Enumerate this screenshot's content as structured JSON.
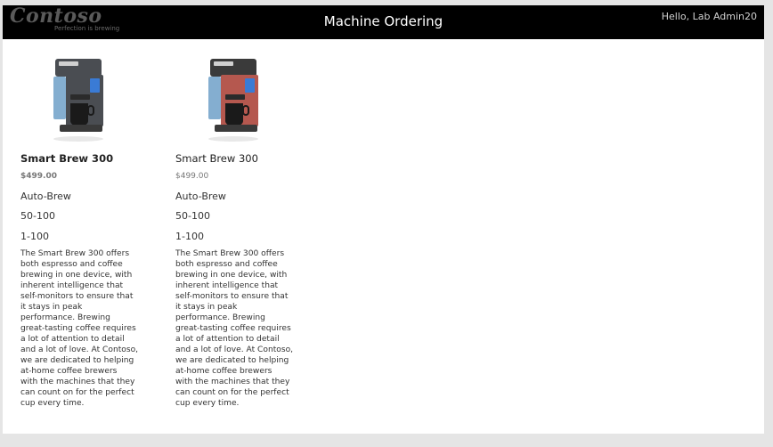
{
  "header": {
    "logo_text": "Contoso",
    "logo_tagline": "Perfection is brewing",
    "title": "Machine Ordering",
    "greeting": "Hello, Lab Admin20"
  },
  "products": [
    {
      "name": "Smart Brew 300",
      "price": "$499.00",
      "brew_type": "Auto-Brew",
      "range_a": "50-100",
      "range_b": "1-100",
      "color": "#4a4d52",
      "description_lines": [
        "The Smart Brew 300 offers",
        "both espresso and coffee",
        "brewing in one device, with",
        "inherent intelligence that",
        "self-monitors to ensure that",
        "it stays in peak",
        "performance. Brewing",
        "great-tasting coffee requires",
        "a lot of attention to detail",
        "and a lot of love. At Contoso,",
        "we are dedicated to helping",
        "at-home coffee brewers",
        "with the machines that they",
        "can count on for the perfect",
        "cup every time."
      ]
    },
    {
      "name": "Smart Brew 300",
      "price": "$499.00",
      "brew_type": "Auto-Brew",
      "range_a": "50-100",
      "range_b": "1-100",
      "color": "#b5584f",
      "description_lines": [
        "The Smart Brew 300 offers",
        "both espresso and coffee",
        "brewing in one device, with",
        "inherent intelligence that",
        "self-monitors to ensure that",
        "it stays in peak",
        "performance. Brewing",
        "great-tasting coffee requires",
        "a lot of attention to detail",
        "and a lot of love. At Contoso,",
        "we are dedicated to helping",
        "at-home coffee brewers",
        "with the machines that they",
        "can count on for the perfect",
        "cup every time."
      ]
    }
  ]
}
